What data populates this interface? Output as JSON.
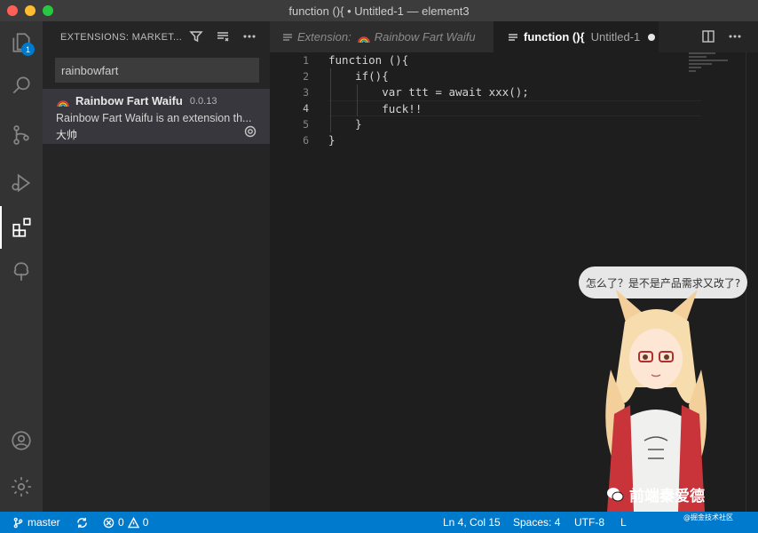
{
  "window": {
    "title": "function (){ • Untitled-1 — element3"
  },
  "activity_bar": {
    "items": [
      {
        "name": "explorer",
        "icon": "files-icon",
        "badge": "1"
      },
      {
        "name": "search",
        "icon": "search-icon"
      },
      {
        "name": "source-control",
        "icon": "source-control-icon"
      },
      {
        "name": "run-debug",
        "icon": "run-debug-icon"
      },
      {
        "name": "extensions",
        "icon": "extensions-icon",
        "active": true
      },
      {
        "name": "tree",
        "icon": "tree-icon"
      }
    ],
    "bottom": [
      {
        "name": "accounts",
        "icon": "account-icon"
      },
      {
        "name": "manage",
        "icon": "gear-icon"
      }
    ]
  },
  "sidebar": {
    "header": "EXTENSIONS: MARKET...",
    "search_value": "rainbowfart",
    "extension": {
      "name": "Rainbow Fart Waifu",
      "version": "0.0.13",
      "description": "Rainbow Fart Waifu is an extension th...",
      "author": "大帅"
    }
  },
  "tabs": [
    {
      "label": "Extension: Rainbow Fart Waifu",
      "prefix": "Extension:",
      "name": "Rainbow Fart Waifu",
      "active": false
    },
    {
      "name": "function (){",
      "file": "Untitled-1",
      "active": true,
      "dirty": true
    }
  ],
  "editor": {
    "line_numbers": [
      "1",
      "2",
      "3",
      "4",
      "5",
      "6"
    ],
    "lines": [
      "function (){",
      "    if(){",
      "        var ttt = await xxx();",
      "        fuck!!",
      "    }",
      "}"
    ],
    "current_line": 4
  },
  "overlay": {
    "bubble_text": "怎么了？是不是产品需求又改了?",
    "watermark_title": "前端秦爱德",
    "watermark_sub": "@掘金技术社区"
  },
  "statusbar": {
    "branch": "master",
    "errors": "0",
    "warnings": "0",
    "position": "Ln 4, Col 15",
    "spaces": "Spaces: 4",
    "encoding": "UTF-8",
    "line_ending": "L"
  },
  "colors": {
    "accent": "#007acc",
    "activity_bg": "#333333",
    "sidebar_bg": "#252526",
    "editor_bg": "#1e1e1e"
  }
}
